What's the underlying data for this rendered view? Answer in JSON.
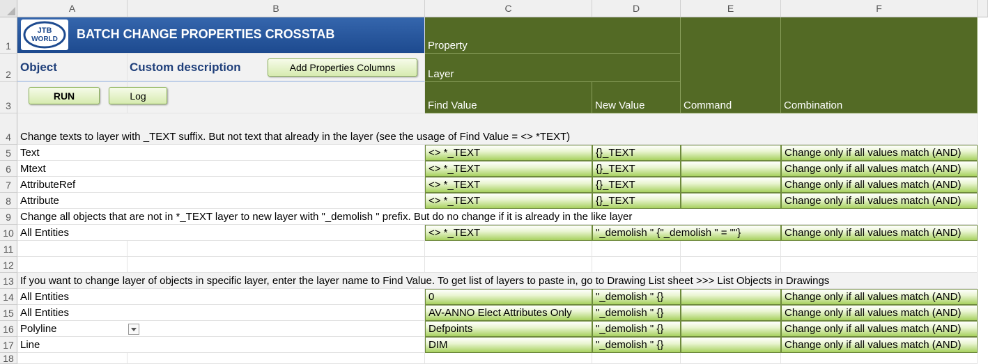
{
  "columns": [
    "A",
    "B",
    "C",
    "D",
    "E",
    "F"
  ],
  "rows": [
    "1",
    "2",
    "3",
    "4",
    "5",
    "6",
    "7",
    "8",
    "9",
    "10",
    "11",
    "12",
    "13",
    "14",
    "15",
    "16",
    "17",
    "18"
  ],
  "logo": {
    "line1": "JTB",
    "line2": "WORLD"
  },
  "title": "BATCH CHANGE PROPERTIES CROSSTAB",
  "labels": {
    "object": "Object",
    "custom_description": "Custom description"
  },
  "buttons": {
    "add_columns": "Add Properties Columns",
    "run": "RUN",
    "log": "Log"
  },
  "headers": {
    "property": "Property",
    "layer": "Layer",
    "find_value": "Find Value",
    "new_value": "New Value",
    "command": "Command",
    "combination": "Combination"
  },
  "notes": {
    "r4": "Change texts to layer with _TEXT suffix. But not text that already in the layer (see the usage of Find Value = <> *TEXT)",
    "r9": "Change all objects that are not in *_TEXT layer to new layer with \"_demolish \" prefix. But do no change if it is already in the like layer",
    "r13": "If you want to change layer of objects in specific layer, enter the layer name to Find Value. To get list of layers to paste in, go to Drawing List sheet >>> List Objects in Drawings"
  },
  "data_rows": [
    {
      "obj": "Text",
      "find": "<> *_TEXT",
      "new": "{}_TEXT",
      "cmd": "",
      "comb": "Change only if all values match (AND)"
    },
    {
      "obj": "Mtext",
      "find": "<> *_TEXT",
      "new": "{}_TEXT",
      "cmd": "",
      "comb": "Change only if all values match (AND)"
    },
    {
      "obj": "AttributeRef",
      "find": "<> *_TEXT",
      "new": "{}_TEXT",
      "cmd": "",
      "comb": "Change only if all values match (AND)"
    },
    {
      "obj": "Attribute",
      "find": "<> *_TEXT",
      "new": "{}_TEXT",
      "cmd": "",
      "comb": "Change only if all values match (AND)"
    },
    {
      "obj": "All Entities",
      "find": "<> *_TEXT",
      "new": "\"_demolish \" {\"_demolish \" = \"\"}",
      "cmd": "",
      "comb": "Change only if all values match (AND)"
    },
    {
      "obj": "All Entities",
      "find": "0",
      "new": "\"_demolish \" {}",
      "cmd": "",
      "comb": "Change only if all values match (AND)"
    },
    {
      "obj": "All Entities",
      "find": "AV-ANNO Elect Attributes Only",
      "new": "\"_demolish \" {}",
      "cmd": "",
      "comb": "Change only if all values match (AND)"
    },
    {
      "obj": "Polyline",
      "find": "Defpoints",
      "new": "\"_demolish \" {}",
      "cmd": "",
      "comb": "Change only if all values match (AND)"
    },
    {
      "obj": "Line",
      "find": "DIM",
      "new": "\"_demolish \" {}",
      "cmd": "",
      "comb": "Change only if all values match (AND)"
    }
  ],
  "colors": {
    "title_blue": "#1d4a8f",
    "header_green": "#536a25",
    "cell_green": "#a8d160"
  }
}
